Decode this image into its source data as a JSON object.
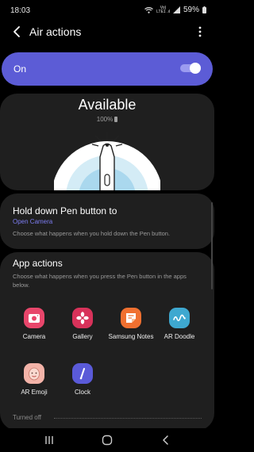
{
  "status_bar": {
    "time": "18:03",
    "network_top": "Vo)",
    "network_bottom": "LTE1 .ıl",
    "battery": "59%"
  },
  "header": {
    "title": "Air actions"
  },
  "master_switch": {
    "label": "On",
    "state": true
  },
  "pen_status": {
    "title": "Available",
    "battery": "100%"
  },
  "hold_pen": {
    "title": "Hold down Pen button to",
    "action": "Open Camera",
    "description": "Choose what happens when you hold down the Pen button."
  },
  "app_actions": {
    "title": "App actions",
    "description": "Choose what happens when you press the Pen button in the apps below.",
    "apps": [
      {
        "label": "Camera",
        "icon": "camera-icon",
        "color": "#e8466b"
      },
      {
        "label": "Gallery",
        "icon": "gallery-icon",
        "color": "#d8325a"
      },
      {
        "label": "Samsung Notes",
        "icon": "notes-icon",
        "color": "#f07030"
      },
      {
        "label": "AR Doodle",
        "icon": "ar-doodle-icon",
        "color": "#3ea8d0"
      },
      {
        "label": "AR Emoji",
        "icon": "ar-emoji-icon",
        "color": "#f3b3a8"
      },
      {
        "label": "Clock",
        "icon": "clock-icon",
        "color": "#5a5ad8"
      }
    ],
    "section_turned_off": "Turned off"
  },
  "colors": {
    "accent": "#5c5cd6",
    "link": "#7c7cf0",
    "card": "#1f1f1f",
    "background": "#000000"
  }
}
